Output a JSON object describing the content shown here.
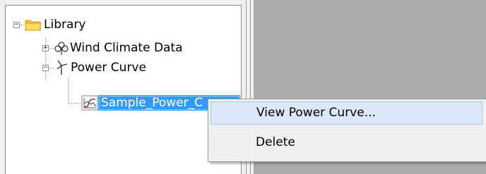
{
  "tree": {
    "root": {
      "label": "Library",
      "expander": "−",
      "icon": "folder-icon"
    },
    "children": [
      {
        "label": "Wind Climate Data",
        "expander": "+",
        "icon": "wind-climate-icon"
      },
      {
        "label": "Power Curve",
        "expander": "−",
        "icon": "turbine-icon",
        "children": [
          {
            "label": "Sample_Power_C",
            "icon": "chart-icon",
            "selected": true
          }
        ]
      }
    ]
  },
  "context_menu": {
    "items": [
      {
        "label": "View Power Curve...",
        "hovered": true
      },
      {
        "label": "Delete",
        "hovered": false
      }
    ]
  },
  "colors": {
    "selection": "#3399ff",
    "menu_hover": "#dbe8f7",
    "workspace": "#ababab",
    "folder": "#f5c542"
  }
}
